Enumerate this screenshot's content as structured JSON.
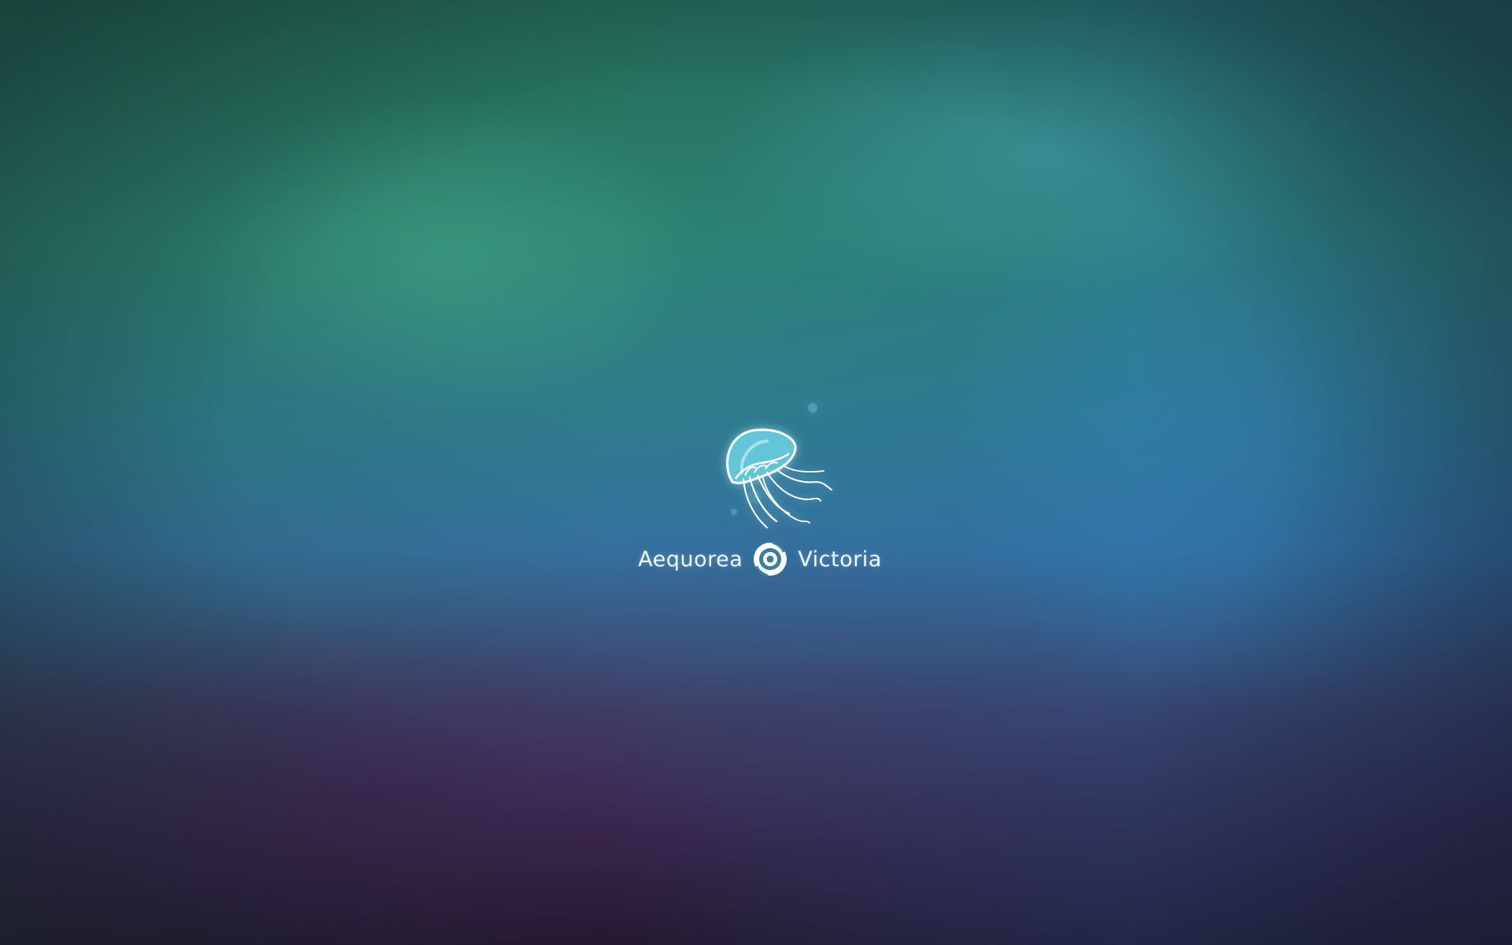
{
  "wallpaper": {
    "colors": {
      "top_green": "#236a55",
      "mid_teal": "#2f7c8e",
      "right_blue": "#35709e",
      "bottom_purple": "#2a1d34"
    }
  },
  "logo": {
    "icon": "jellyfish-icon",
    "emblem_icon": "spiral-emblem-icon",
    "word_left": "Aequorea",
    "word_right": "Victoria",
    "glow_color": "#a8f0ff"
  }
}
